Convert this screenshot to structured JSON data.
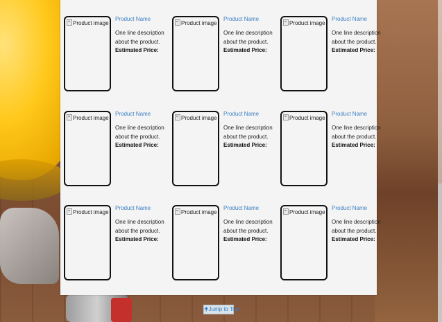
{
  "products": [
    {
      "image_alt": "Product image",
      "name": "Product Name",
      "desc_line1": "One line description",
      "desc_line2": "about the product.",
      "price_label": "Estimated Price:"
    },
    {
      "image_alt": "Product image",
      "name": "Product Name",
      "desc_line1": "One line description",
      "desc_line2": "about the product.",
      "price_label": "Estimated Price:"
    },
    {
      "image_alt": "Product image",
      "name": "Product Name",
      "desc_line1": "One line description",
      "desc_line2": "about the product.",
      "price_label": "Estimated Price:"
    },
    {
      "image_alt": "Product image",
      "name": "Product Name",
      "desc_line1": "One line description",
      "desc_line2": "about the product.",
      "price_label": "Estimated Price:"
    },
    {
      "image_alt": "Product image",
      "name": "Product Name",
      "desc_line1": "One line description",
      "desc_line2": "about the product.",
      "price_label": "Estimated Price:"
    },
    {
      "image_alt": "Product image",
      "name": "Product Name",
      "desc_line1": "One line description",
      "desc_line2": "about the product.",
      "price_label": "Estimated Price:"
    },
    {
      "image_alt": "Product image",
      "name": "Product Name",
      "desc_line1": "One line description",
      "desc_line2": "about the product.",
      "price_label": "Estimated Price:"
    },
    {
      "image_alt": "Product image",
      "name": "Product Name",
      "desc_line1": "One line description",
      "desc_line2": "about the product.",
      "price_label": "Estimated Price:"
    },
    {
      "image_alt": "Product image",
      "name": "Product Name",
      "desc_line1": "One line description",
      "desc_line2": "about the product.",
      "price_label": "Estimated Price:"
    }
  ],
  "jump_to_top": {
    "label": "Jump to Top",
    "icon": "up-arrow-icon"
  },
  "colors": {
    "link": "#3a7fc4",
    "panel": "#f4f4f4"
  }
}
